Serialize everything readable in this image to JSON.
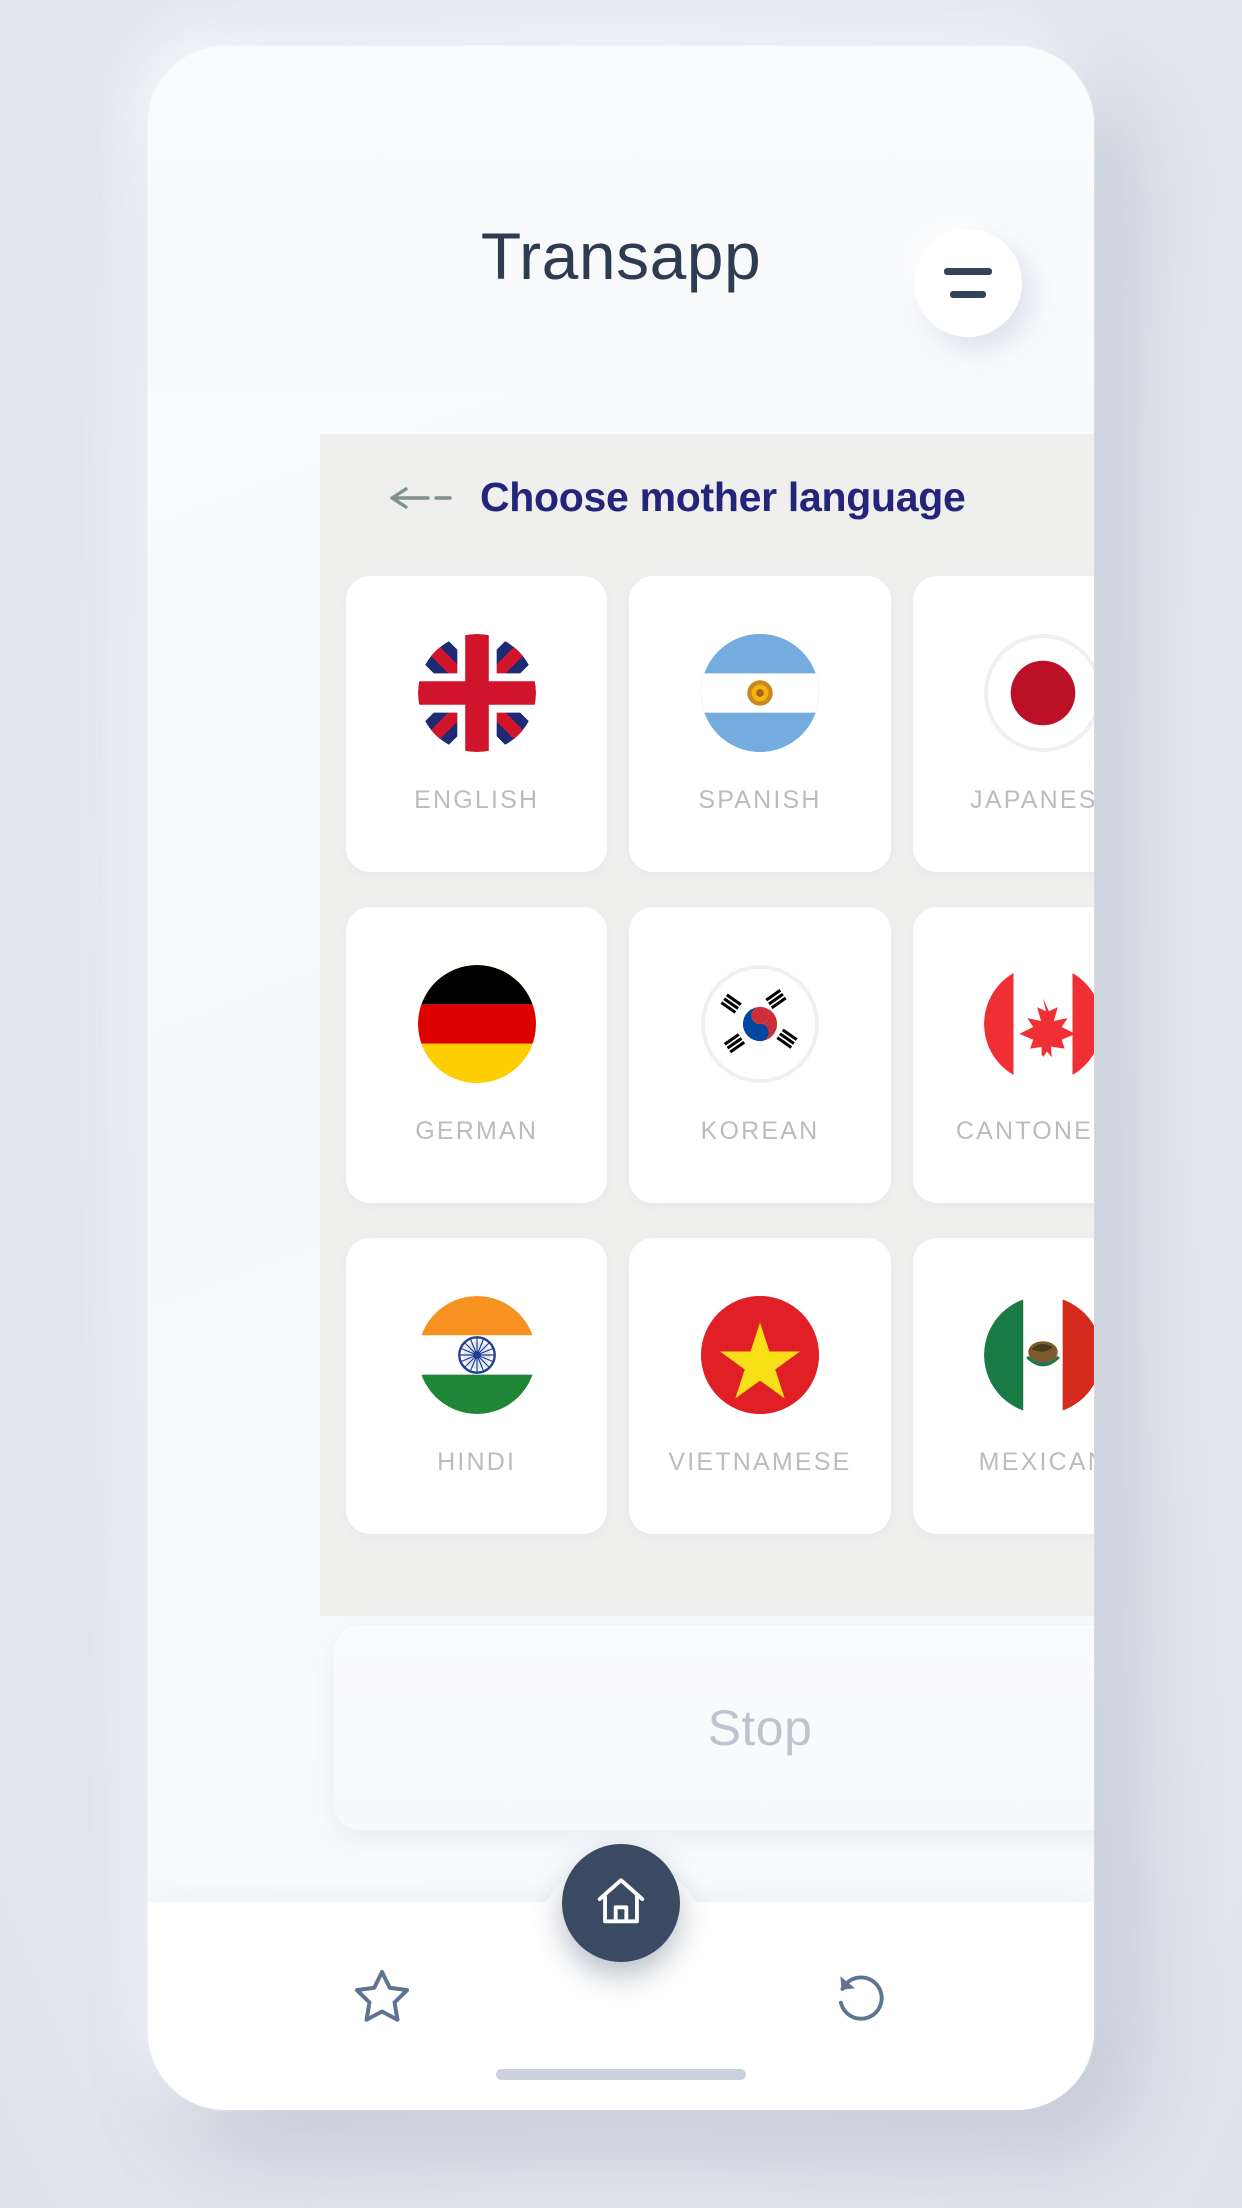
{
  "app": {
    "title": "Transapp",
    "menu_icon": "hamburger-icon"
  },
  "panel": {
    "back_icon": "back-arrow-icon",
    "title": "Choose mother language"
  },
  "languages": [
    {
      "label": "ENGLISH",
      "flag": "uk-flag-icon",
      "flag_code": "uk"
    },
    {
      "label": "SPANISH",
      "flag": "argentina-flag-icon",
      "flag_code": "es"
    },
    {
      "label": "JAPANESE",
      "flag": "japan-flag-icon",
      "flag_code": "jp"
    },
    {
      "label": "GERMAN",
      "flag": "germany-flag-icon",
      "flag_code": "de"
    },
    {
      "label": "KOREAN",
      "flag": "korea-flag-icon",
      "flag_code": "kr"
    },
    {
      "label": "CANTONESE",
      "flag": "canada-flag-icon",
      "flag_code": "ca"
    },
    {
      "label": "HINDI",
      "flag": "india-flag-icon",
      "flag_code": "in"
    },
    {
      "label": "VIETNAMESE",
      "flag": "vietnam-flag-icon",
      "flag_code": "vn"
    },
    {
      "label": "MEXICAN",
      "flag": "mexico-flag-icon",
      "flag_code": "mx"
    }
  ],
  "action": {
    "stop_label": "Stop"
  },
  "bottom_nav": {
    "items": [
      {
        "icon": "star-icon"
      },
      {
        "icon": "home-icon"
      },
      {
        "icon": "refresh-icon"
      }
    ]
  },
  "colors": {
    "background": "#e6e9f1",
    "phone": "#f8fafc",
    "panel": "#efefee",
    "title_text": "#2e3c52",
    "heading_text": "#23257a",
    "label_text": "#bcbcbc",
    "accent_dark": "#3a4a63",
    "stop_text": "#bfc3cd"
  }
}
